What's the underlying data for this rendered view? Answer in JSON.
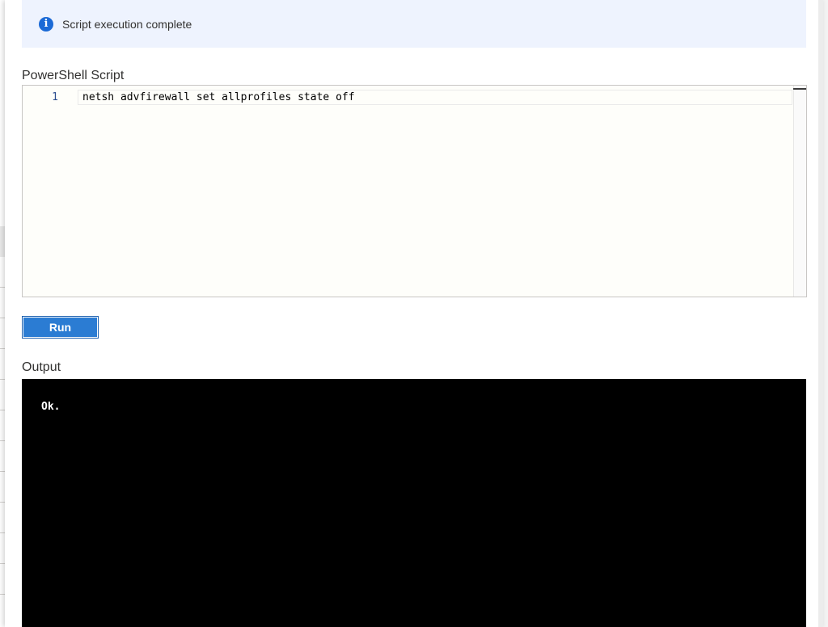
{
  "notification": {
    "icon": "info-icon",
    "icon_glyph": "i",
    "icon_color": "#1b6ad6",
    "background_color": "#eef3fe",
    "message": "Script execution complete"
  },
  "script_section": {
    "label": "PowerShell Script",
    "editor": {
      "lines": [
        {
          "number": "1",
          "code": "netsh advfirewall set allprofiles state off"
        }
      ]
    }
  },
  "run_button": {
    "label": "Run",
    "color": "#2b7cd3"
  },
  "output_section": {
    "label": "Output",
    "background_color": "#000000",
    "text": "Ok."
  }
}
